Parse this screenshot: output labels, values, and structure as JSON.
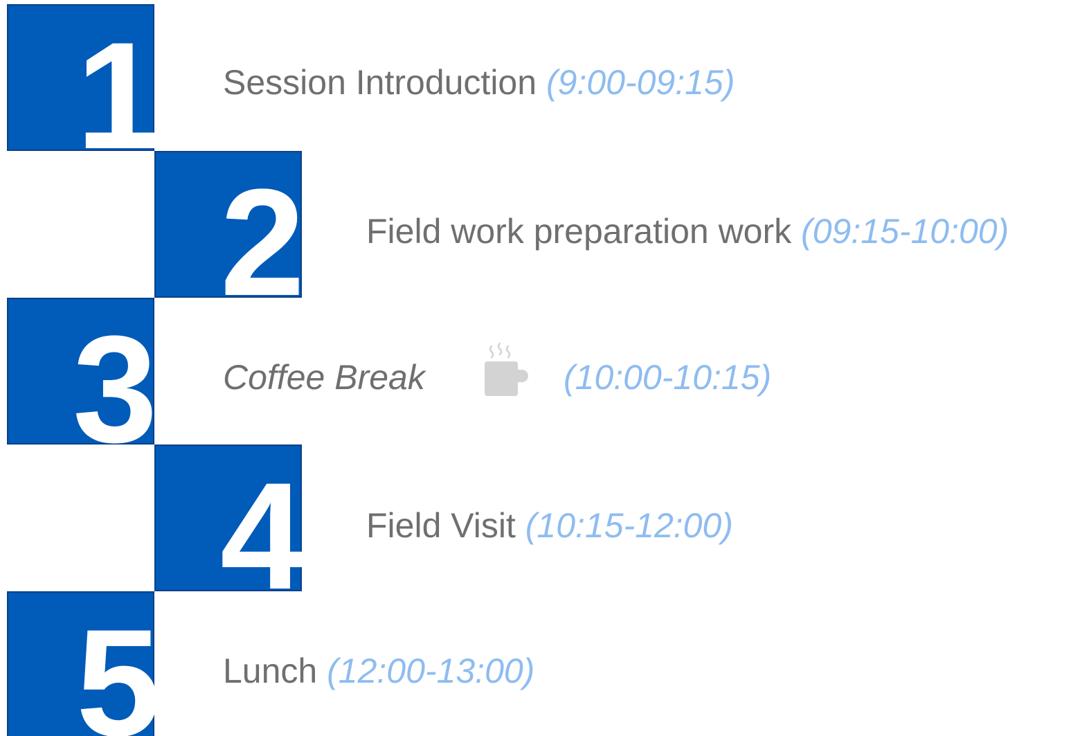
{
  "agenda": {
    "items": [
      {
        "number": "1",
        "label": "Session Introduction",
        "time": "(9:00-09:15)"
      },
      {
        "number": "2",
        "label": "Field work preparation work",
        "time": "(09:15-10:00)"
      },
      {
        "number": "3",
        "label": "Coffee Break",
        "time": "(10:00-10:15)",
        "icon": "coffee-cup-icon"
      },
      {
        "number": "4",
        "label": "Field Visit",
        "time": "(10:15-12:00)"
      },
      {
        "number": "5",
        "label": "Lunch",
        "time": "(12:00-13:00)"
      }
    ],
    "colors": {
      "block": "#005bb9",
      "block_border": "#0d3f87",
      "number": "#ffffff",
      "label": "#6f6f6f",
      "time": "#8ebcf0",
      "icon": "#d3d3d3"
    }
  }
}
